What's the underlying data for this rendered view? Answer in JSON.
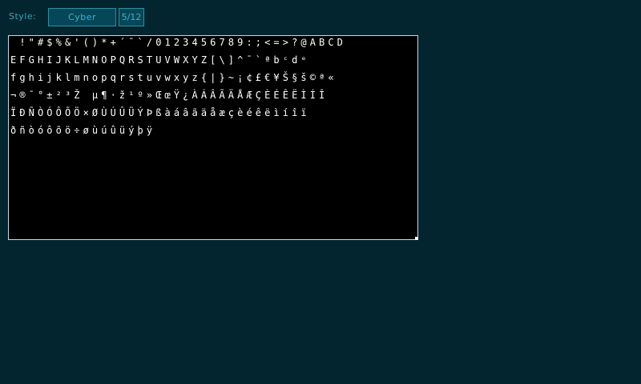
{
  "toolbar": {
    "style_label": "Style:",
    "style_value": "Cyber",
    "page_counter": "5/12"
  },
  "preview": {
    "rows": [
      " !\"#$%&'()*+´¯`/0123456789:;<=>?@ABCD",
      "EFGHIJKLMNOPQRSTUVWXYZ[\\]^¯`ªbᶜdᵉ",
      "fghijklmnopqrstuvwxyz{|}~¡¢£€¥Š§š©ª«",
      "¬®¯°±²³Ž µ¶·ž¹º»ŒœŸ¿ÀÁÂÃÄÅÆÇÈÉÊËÌÍÎ",
      "ÏÐÑÒÓÔÕÖ×ØÙÚÛÜÝÞßàáâãäåæçèéêëìíîï",
      "ðñòóôõö÷øùúûüýþÿ"
    ]
  }
}
